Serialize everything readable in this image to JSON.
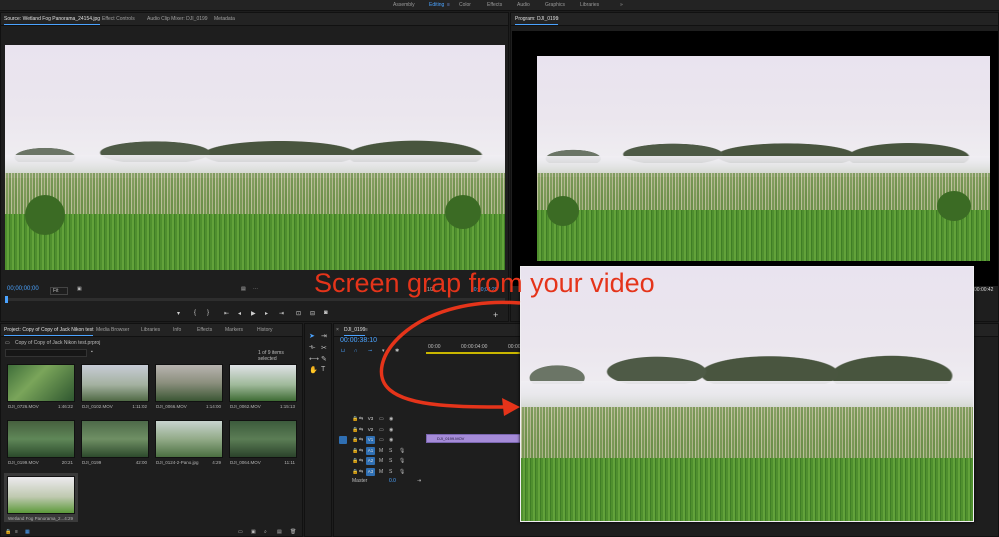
{
  "workspaces": {
    "items": [
      "Assembly",
      "Editing",
      "Color",
      "Effects",
      "Audio",
      "Graphics",
      "Libraries"
    ],
    "active": "Editing",
    "more": "»"
  },
  "source_panel": {
    "tabs": [
      "Source: Wetland Fog Panorama_24154.jpg",
      "Effect Controls",
      "Audio Clip Mixer: DJI_0199",
      "Metadata"
    ],
    "timecode": "00;00;00;00",
    "fit": "Fit",
    "end_timecode": "00;00;04;29",
    "page_indicator": "1/2"
  },
  "program_panel": {
    "tab": "Program: DJI_0199",
    "end_timecode": "00:00:42"
  },
  "project_panel": {
    "tabs": [
      "Project: Copy of Copy of Jack Nikon test",
      "Media Browser",
      "Libraries",
      "Info",
      "Effects",
      "Markers",
      "History"
    ],
    "file": "Copy of Copy of Jack Nikon test.prproj",
    "search_placeholder": "",
    "selection_status": "1 of 9 items selected",
    "items": [
      {
        "name": "DJI_0726.MOV",
        "duration": "1:46:22"
      },
      {
        "name": "DJI_0102.MOV",
        "duration": "1:11:02"
      },
      {
        "name": "DJI_0066.MOV",
        "duration": "1:14:00"
      },
      {
        "name": "DJI_0062.MOV",
        "duration": "1:15:13"
      },
      {
        "name": "DJI_0199.MOV",
        "duration": "20:21"
      },
      {
        "name": "DJI_0199",
        "duration": "42:00"
      },
      {
        "name": "DJI_0124-2-Pano.jpg",
        "duration": "4:29"
      },
      {
        "name": "DJI_0064.MOV",
        "duration": "11:11"
      },
      {
        "name": "Wetland Fog Panorama_2...",
        "duration": "4:29"
      }
    ]
  },
  "timeline": {
    "tab": "DJI_0199",
    "timecode": "00:00:38:10",
    "ruler": [
      "00:00",
      "00:00:04:00",
      "00:00"
    ],
    "video_tracks": [
      "V3",
      "V2",
      "V1"
    ],
    "audio_tracks": [
      "A1",
      "A2",
      "A3"
    ],
    "track_letters": [
      "M",
      "S"
    ],
    "master_label": "Master",
    "master_value": "0.0",
    "clip_label": "DJI_0199.MOV"
  },
  "overlay": {
    "annotation": "Screen grap from your video"
  },
  "colors": {
    "accent": "#4ba3ff",
    "annotation": "#e5341a",
    "clip": "#a58bd8"
  }
}
